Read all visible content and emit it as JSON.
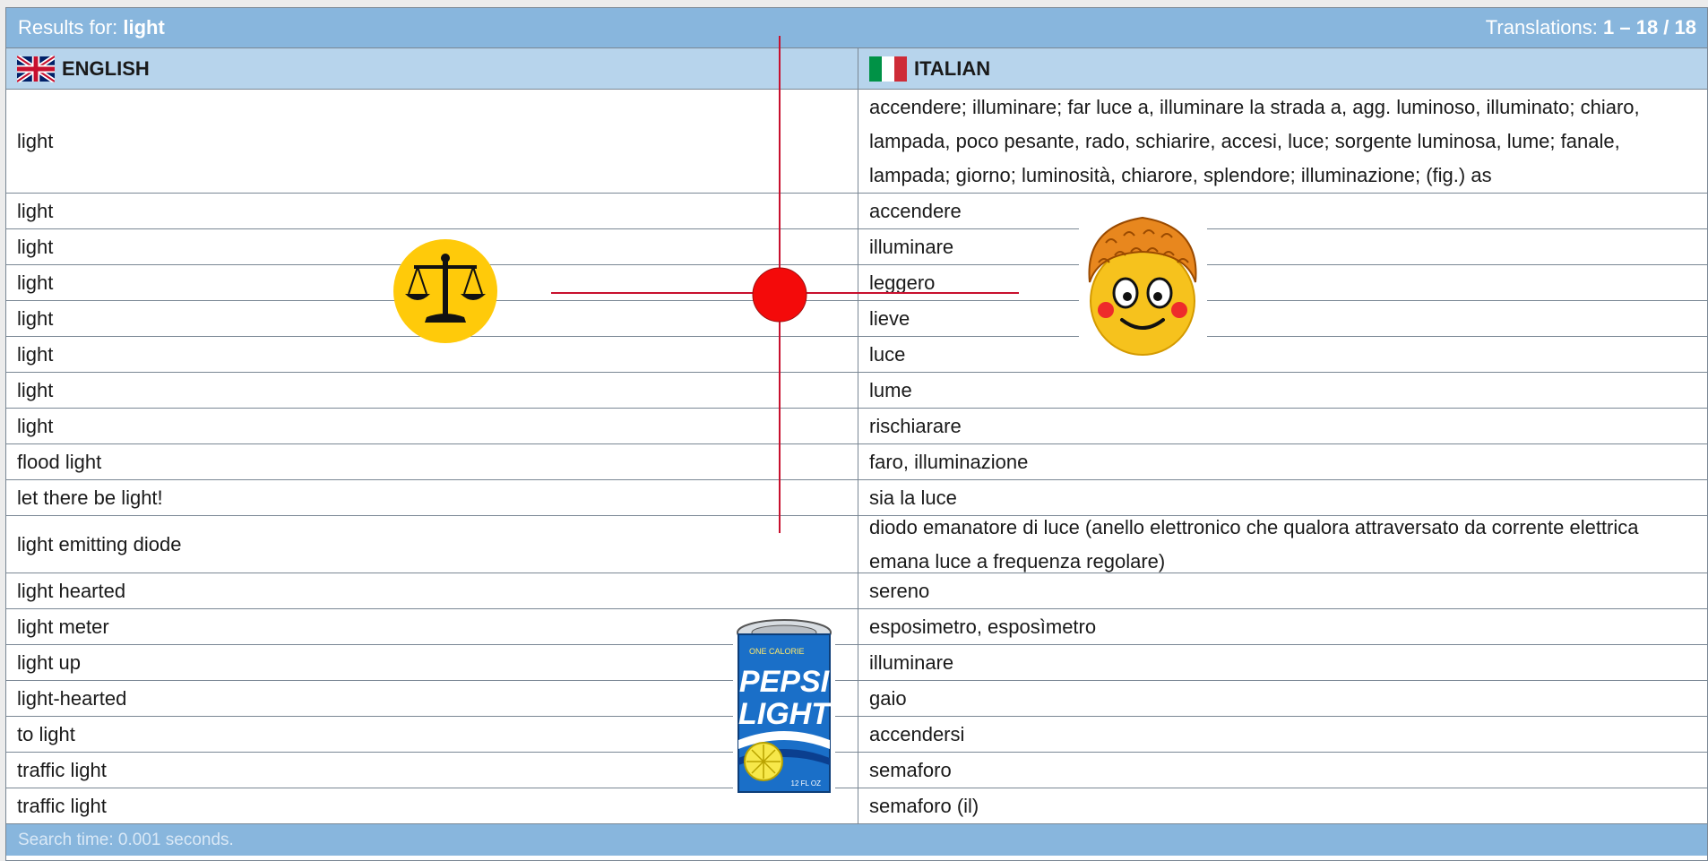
{
  "header": {
    "results_prefix": "Results for:",
    "query": "light",
    "translations_prefix": "Translations:",
    "translations_range": "1 – 18 / 18"
  },
  "columns": {
    "english": {
      "label": "ENGLISH",
      "flag_icon": "uk-flag-icon"
    },
    "italian": {
      "label": "ITALIAN",
      "flag_icon": "italy-flag-icon"
    }
  },
  "rows": [
    {
      "en": "light",
      "it": "accendere; illuminare; far luce a, illuminare la strada a, agg. luminoso, illuminato; chiaro, lampada, poco pesante, rado, schiarire, accesi, luce; sorgente luminosa, lume; fanale, lampada; giorno; luminosità, chiarore, splendore; illuminazione; (fig.) as"
    },
    {
      "en": "light",
      "it": "accendere"
    },
    {
      "en": "light",
      "it": "illuminare"
    },
    {
      "en": "light",
      "it": "leggero"
    },
    {
      "en": "light",
      "it": "lieve"
    },
    {
      "en": "light",
      "it": "luce"
    },
    {
      "en": "light",
      "it": "lume"
    },
    {
      "en": "light",
      "it": "rischiarare"
    },
    {
      "en": "flood light",
      "it": "faro, illuminazione"
    },
    {
      "en": "let there be light!",
      "it": "sia la luce"
    },
    {
      "en": "light emitting diode",
      "it": "diodo emanatore di luce (anello elettronico che qualora attraversato da corrente elettrica emana luce a frequenza regolare)"
    },
    {
      "en": "light hearted",
      "it": "sereno"
    },
    {
      "en": "light meter",
      "it": "esposimetro, esposìmetro"
    },
    {
      "en": "light up",
      "it": "illuminare"
    },
    {
      "en": "light-hearted",
      "it": "gaio"
    },
    {
      "en": "to light",
      "it": "accendersi"
    },
    {
      "en": "traffic light",
      "it": "semaforo"
    },
    {
      "en": "traffic light",
      "it": "semaforo (il)"
    }
  ],
  "footer": {
    "search_time": "Search time: 0.001 seconds."
  },
  "overlays": {
    "can_brand": "PEPSI",
    "can_product": "LIGHT",
    "can_top_text": "ONE CALORIE",
    "can_volume": "12 FL OZ",
    "crosshair_color": "#c8102e"
  },
  "colors": {
    "bar": "#88b6dd",
    "header_row": "#b7d4ec",
    "border": "#7a8794"
  }
}
